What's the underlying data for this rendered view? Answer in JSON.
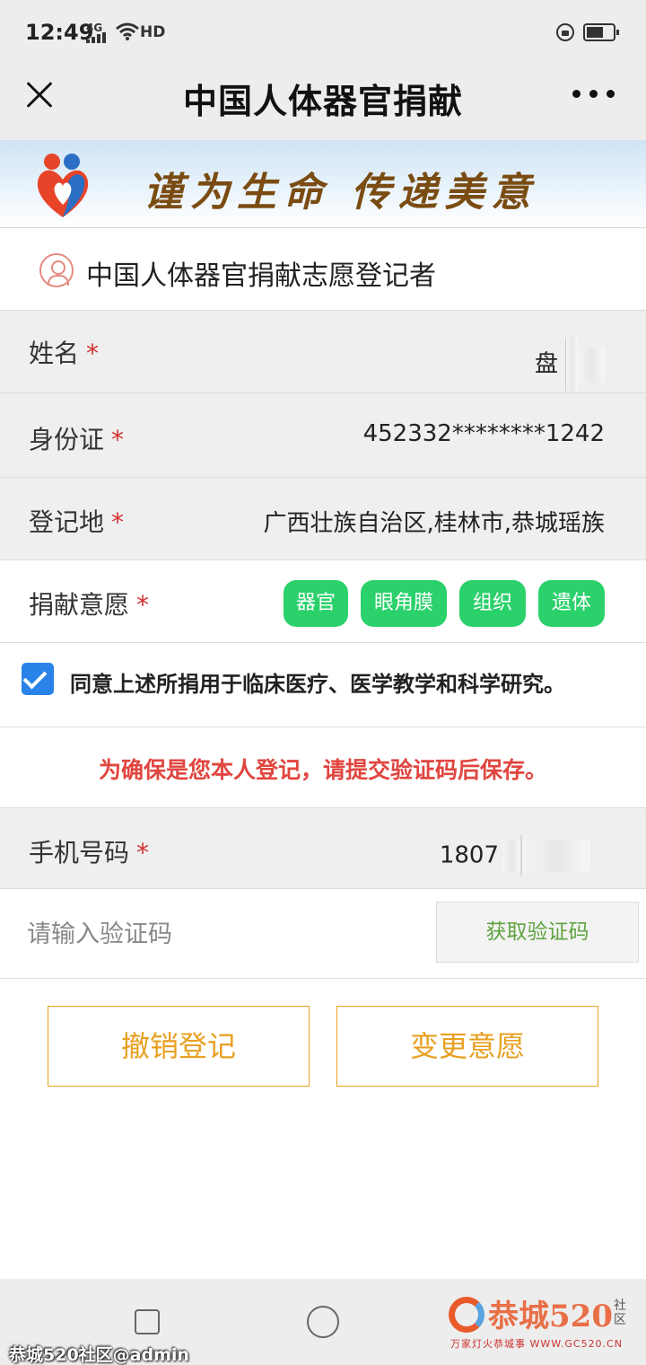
{
  "status_bar": {
    "time": "12:49",
    "network": "4G",
    "hd": "HD"
  },
  "nav": {
    "title": "中国人体器官捐献"
  },
  "banner": {
    "slogan": "谨为生命 传递美意"
  },
  "section": {
    "title": "中国人体器官捐献志愿登记者"
  },
  "form": {
    "name": {
      "label": "姓名",
      "required": "*",
      "value": "盘"
    },
    "id_card": {
      "label": "身份证",
      "required": "*",
      "value": "452332********1242"
    },
    "register_place": {
      "label": "登记地",
      "required": "*",
      "value": "广西壮族自治区,桂林市,恭城瑶族"
    },
    "donation_wish": {
      "label": "捐献意愿",
      "required": "*",
      "tags": [
        "器官",
        "眼角膜",
        "组织",
        "遗体"
      ]
    },
    "agree_text": "同意上述所捐用于临床医疗、医学教学和科学研究。",
    "notice": "为确保是您本人登记，请提交验证码后保存。",
    "phone": {
      "label": "手机号码",
      "required": "*",
      "value": "1807"
    },
    "code": {
      "placeholder": "请输入验证码",
      "button": "获取验证码"
    }
  },
  "actions": {
    "cancel": "撤销登记",
    "change": "变更意愿"
  },
  "watermark": {
    "logo_text": "恭城520",
    "logo_side": "社区",
    "logo_sub": "万家灯火恭城事 WWW.GC520.CN",
    "text": "恭城520社区@admin"
  },
  "colors": {
    "accent_green": "#2bd16b",
    "checkbox_blue": "#2a83e8",
    "notice_red": "#e0453f",
    "action_orange": "#e8a021",
    "code_button_green": "#5fa340"
  }
}
